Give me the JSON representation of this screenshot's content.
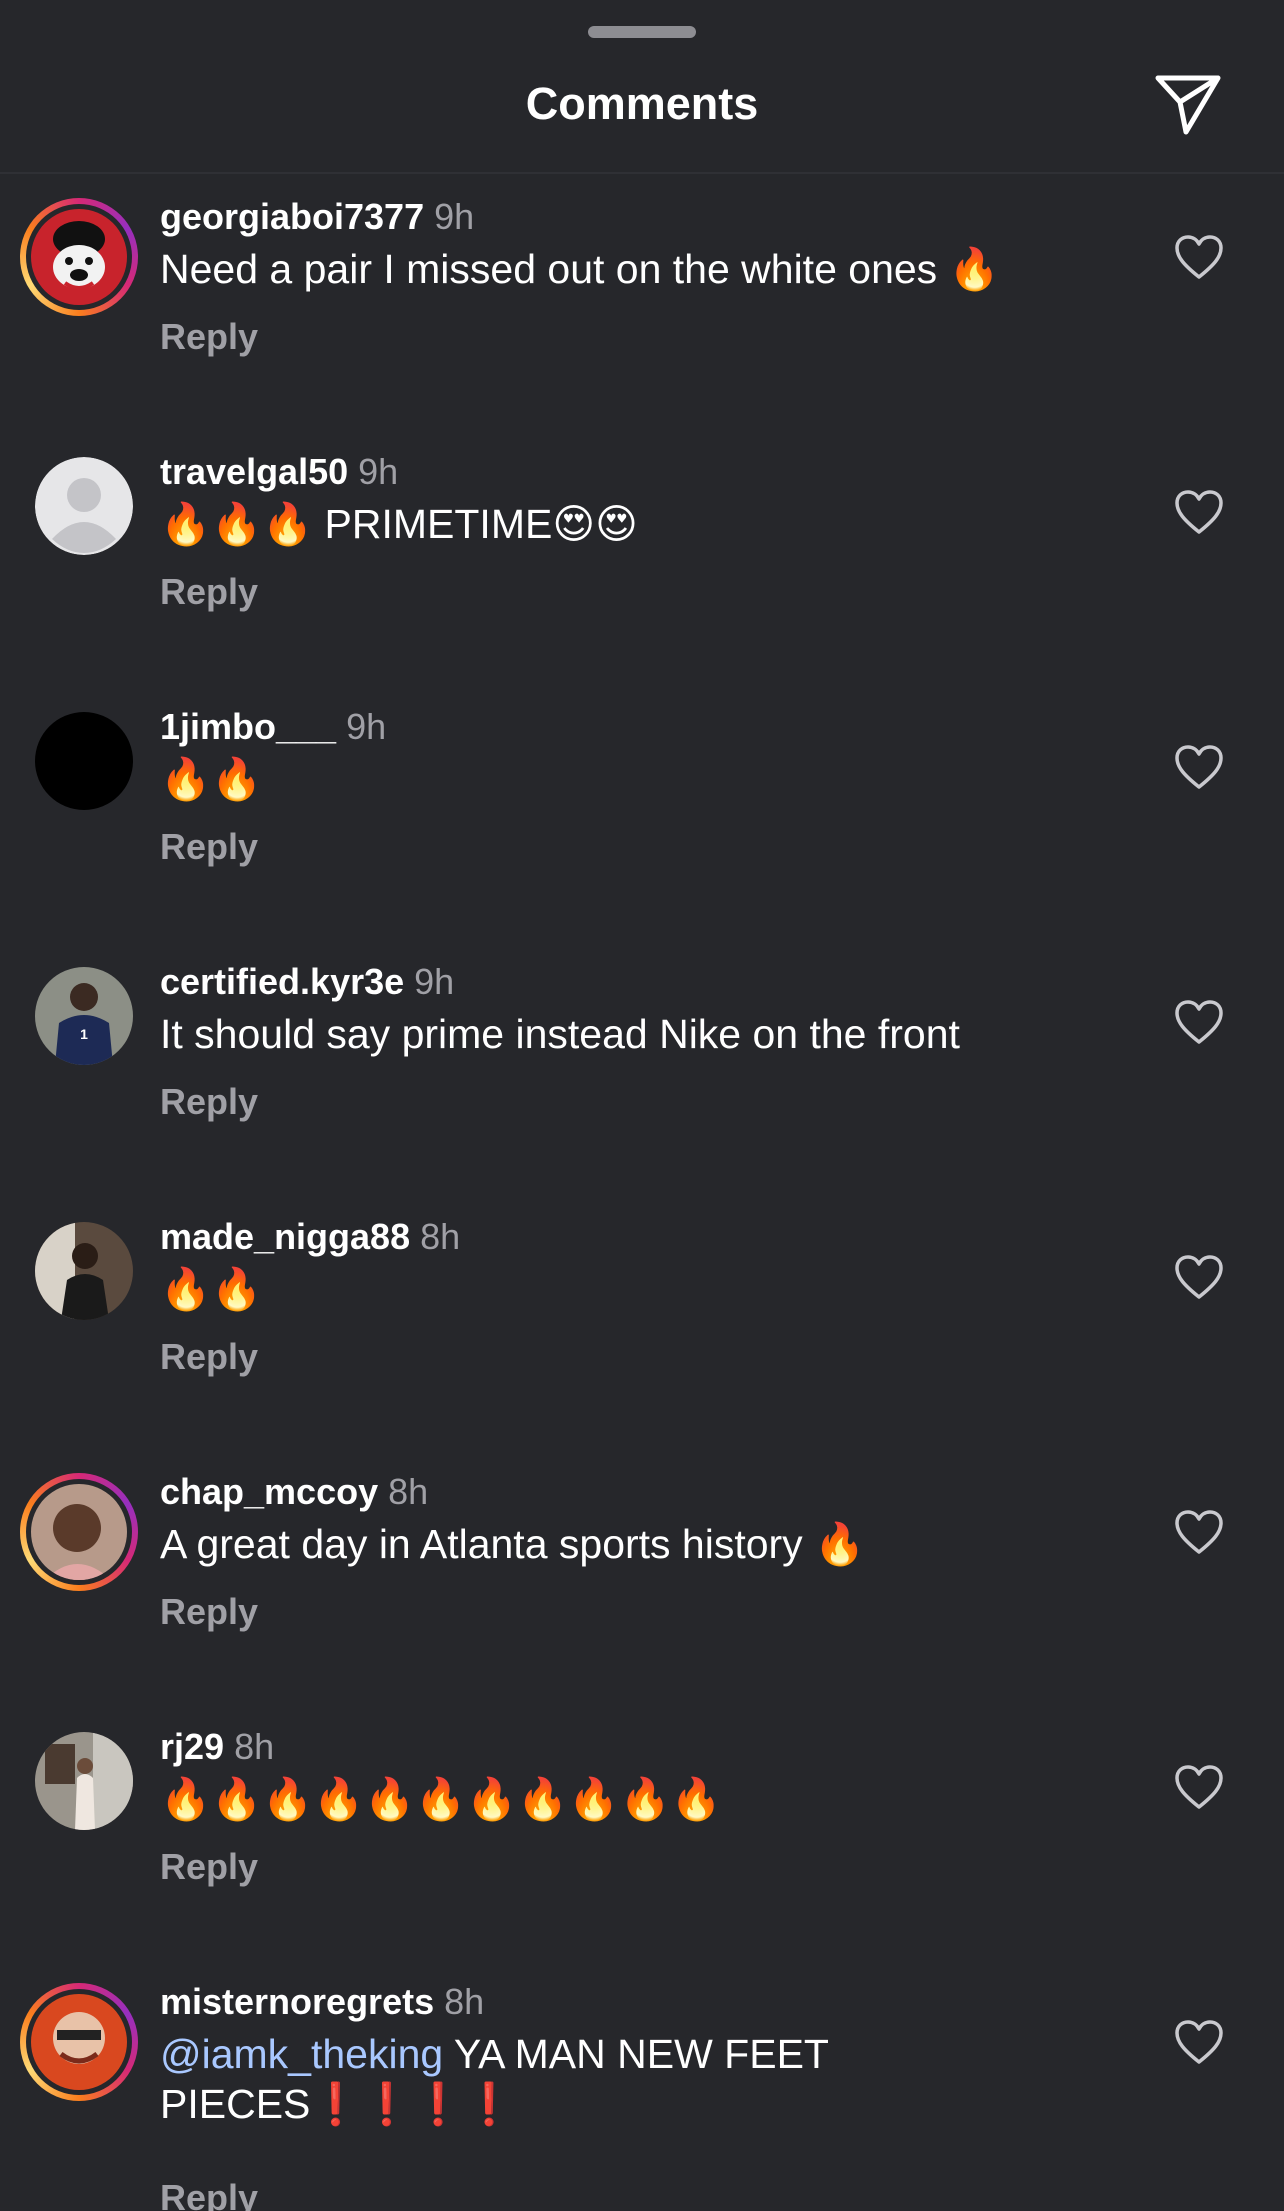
{
  "header": {
    "title": "Comments"
  },
  "colors": {
    "background": "#26272b",
    "mention": "#a9c8ff",
    "secondary_text": "#a0a0a6"
  },
  "comments": [
    {
      "username": "georgiaboi7377",
      "time": "9h",
      "text": "Need a pair I missed out on the white ones 🔥",
      "reply": "Reply",
      "avatar_icon": "bulldog-logo"
    },
    {
      "username": "travelgal50",
      "time": "9h",
      "text": "🔥🔥🔥 PRIMETIME😍😍",
      "reply": "Reply",
      "avatar_icon": "default-person"
    },
    {
      "username": "1jimbo___",
      "time": "9h",
      "text": "🔥🔥",
      "reply": "Reply",
      "avatar_icon": "black-circle"
    },
    {
      "username": "certified.kyr3e",
      "time": "9h",
      "text": "It should say prime instead Nike on the front",
      "reply": "Reply",
      "avatar_icon": "photo"
    },
    {
      "username": "made_nigga88",
      "time": "8h",
      "text": "🔥🔥",
      "reply": "Reply",
      "avatar_icon": "photo"
    },
    {
      "username": "chap_mccoy",
      "time": "8h",
      "text": "A great day in Atlanta sports history 🔥",
      "reply": "Reply",
      "avatar_icon": "photo"
    },
    {
      "username": "rj29",
      "time": "8h",
      "text": "🔥🔥🔥🔥🔥🔥🔥🔥🔥🔥🔥",
      "reply": "Reply",
      "avatar_icon": "photo"
    },
    {
      "username": "misternoregrets",
      "time": "8h",
      "mention": "@iamk_theking",
      "text": " YA MAN NEW FEET PIECES❗️❗️❗️❗️",
      "reply": "Reply",
      "avatar_icon": "photo"
    }
  ]
}
